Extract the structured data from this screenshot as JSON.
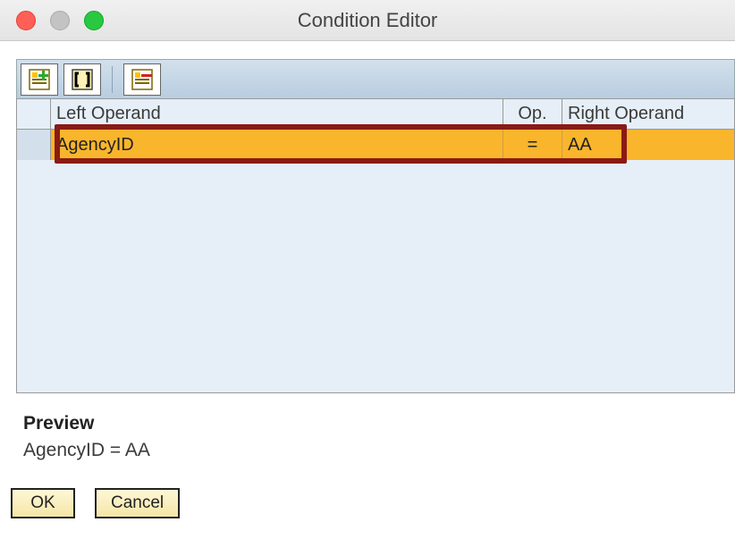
{
  "window": {
    "title": "Condition Editor"
  },
  "toolbar": {
    "add_icon": "add-row-icon",
    "brackets_icon": "brackets-icon",
    "remove_icon": "remove-row-icon"
  },
  "grid": {
    "headers": {
      "left_operand": "Left Operand",
      "operator": "Op.",
      "right_operand": "Right Operand"
    },
    "rows": [
      {
        "left_operand": "AgencyID",
        "operator": "=",
        "right_operand": "AA",
        "selected": true,
        "highlighted": true
      }
    ]
  },
  "preview": {
    "label": "Preview",
    "expression": "AgencyID = AA"
  },
  "buttons": {
    "ok": "OK",
    "cancel": "Cancel"
  }
}
